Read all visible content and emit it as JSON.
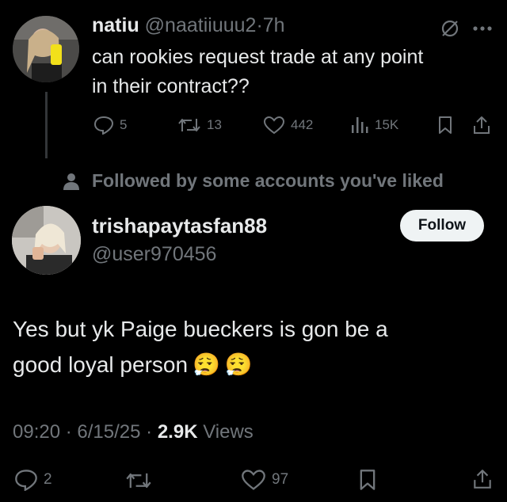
{
  "parent": {
    "display_name": "natiu",
    "handle": "@naatiiuuu2",
    "separator": "·",
    "time": "7h",
    "text_line1": "can rookies request trade at any point",
    "text_line2": "in their contract??",
    "metrics": {
      "replies": "5",
      "reposts": "13",
      "likes": "442",
      "views": "15K"
    }
  },
  "social_context": "Followed by some accounts you've liked",
  "reply": {
    "display_name": "trishapaytasfan88",
    "handle": "@user970456",
    "follow_label": "Follow",
    "text_line1": "Yes but yk Paige bueckers is gon be a",
    "text_line2": "good loyal person",
    "emojis": [
      "😮‍💨",
      "😮‍💨"
    ],
    "time": "09:20",
    "sep1": "·",
    "date": "6/15/25",
    "sep2": "·",
    "views_count": "2.9K",
    "views_label": "Views",
    "metrics": {
      "replies": "2",
      "likes": "97"
    }
  },
  "colors": {
    "background": "#000000",
    "text": "#e7e9ea",
    "muted": "#71767b",
    "button_bg": "#eff3f4"
  }
}
